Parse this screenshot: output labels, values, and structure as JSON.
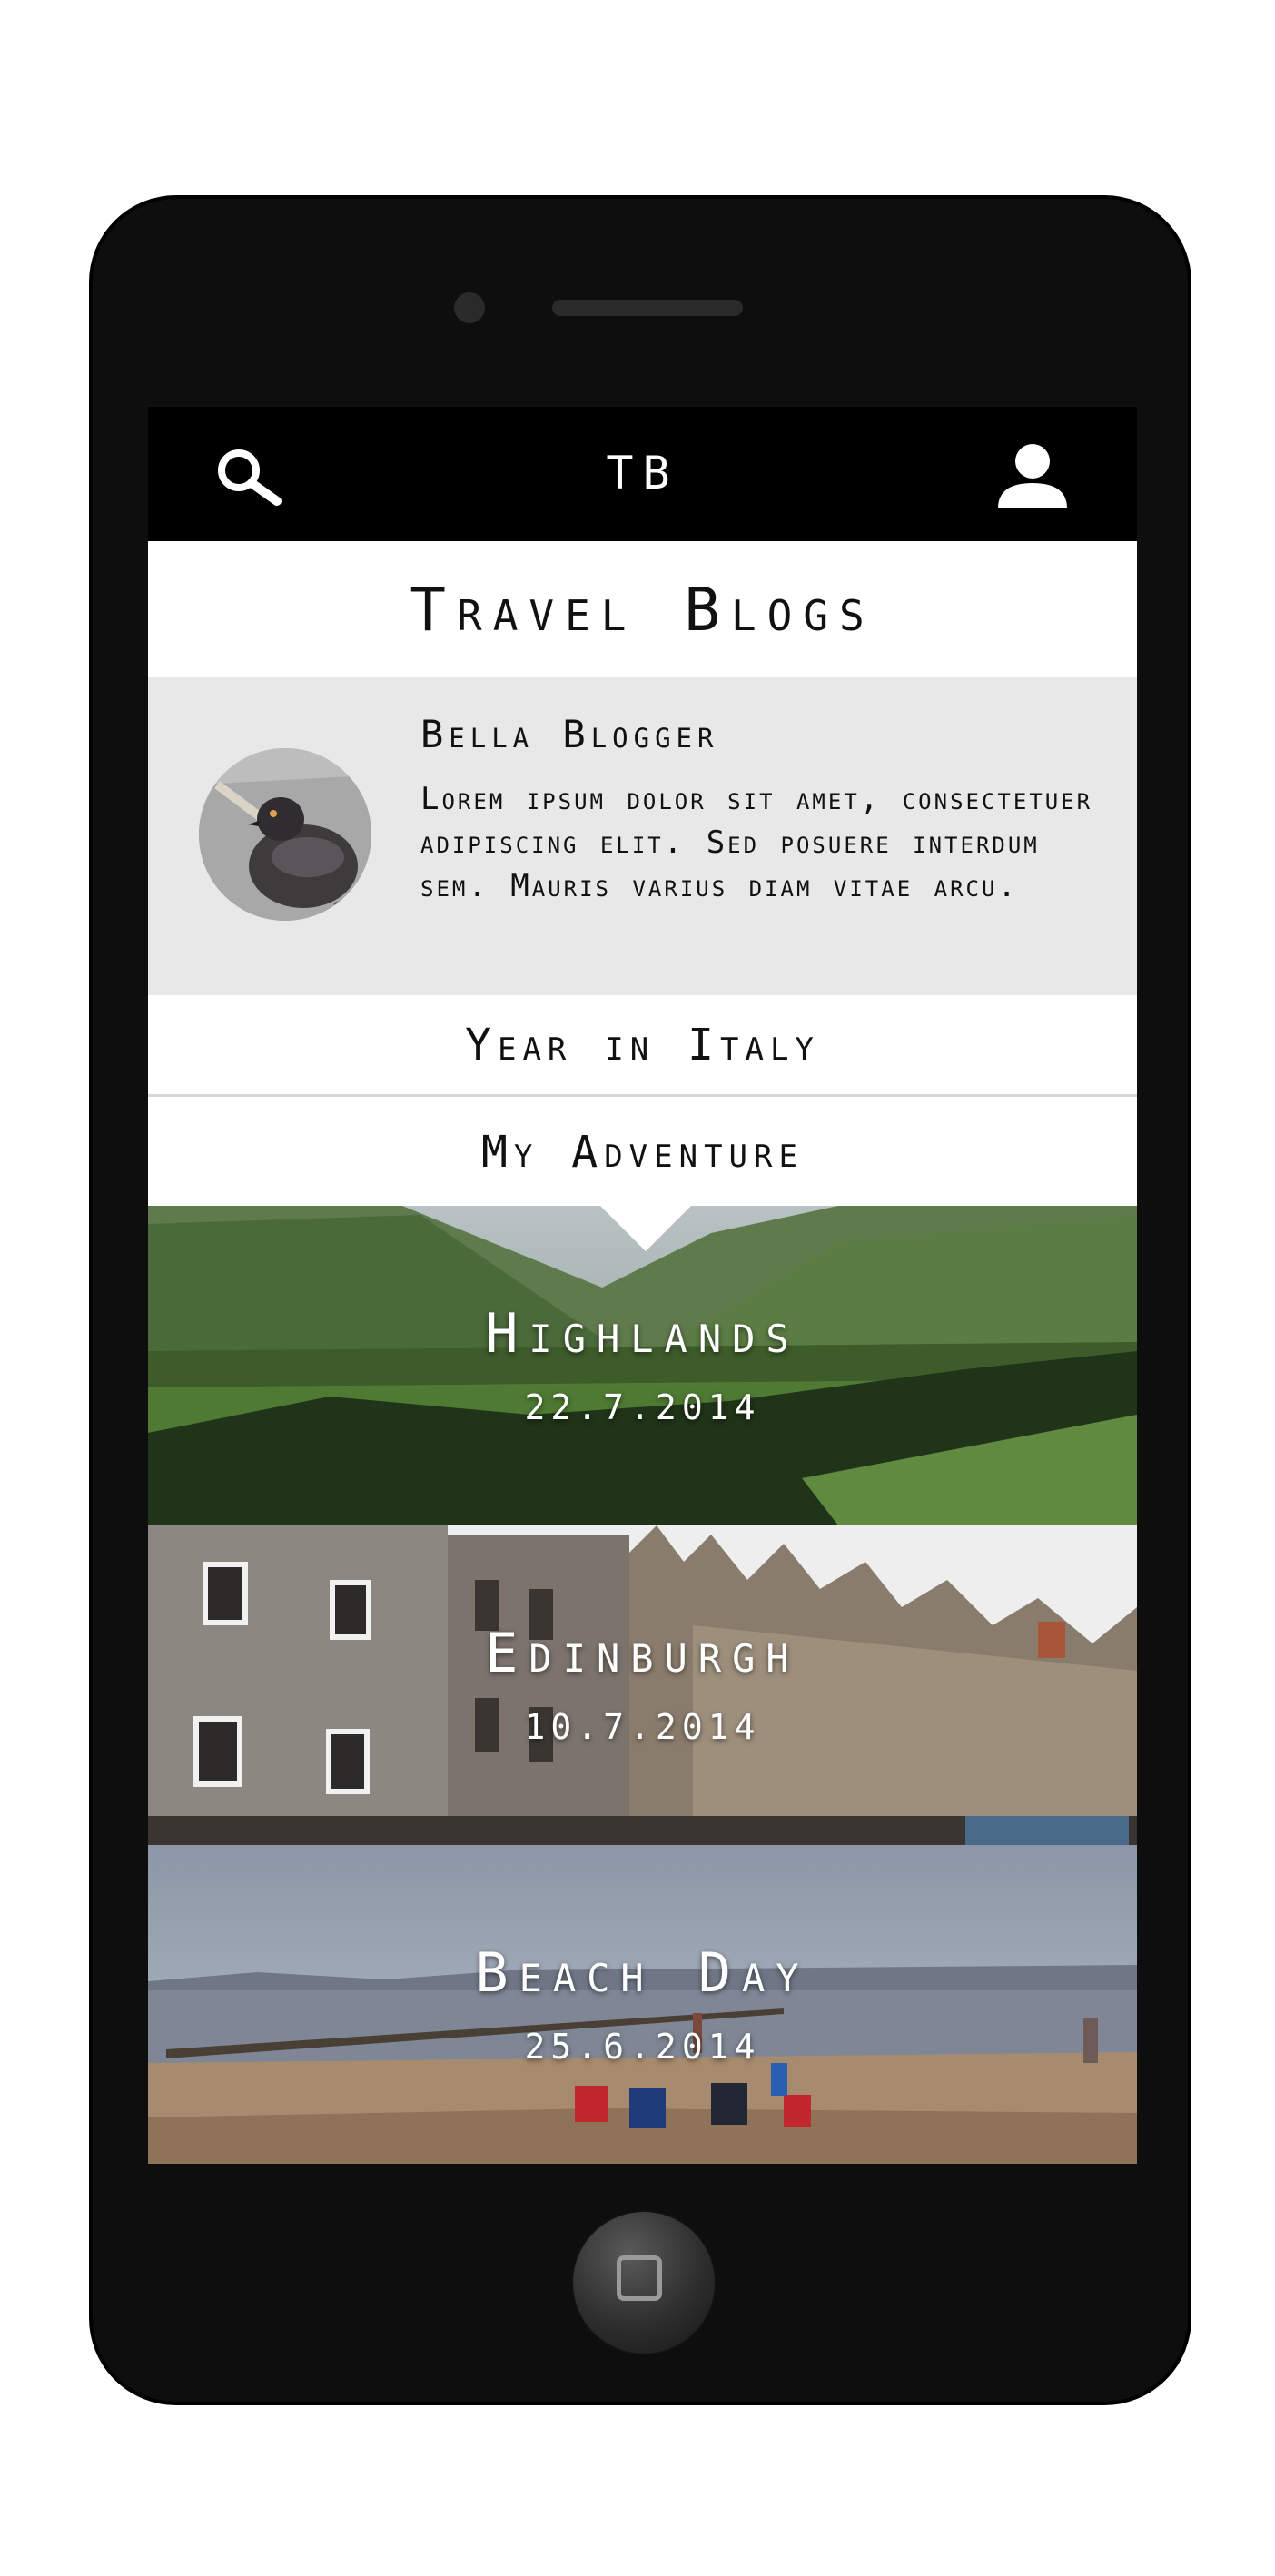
{
  "app": {
    "brand": "TB"
  },
  "header": {
    "title": "Travel Blogs"
  },
  "profile": {
    "name": "Bella Blogger",
    "bio": "Lorem ipsum dolor sit amet, consectetuer adipiscing elit. Sed posuere interdum sem. Mauris varius diam vitae arcu."
  },
  "tabs": [
    {
      "label": "Year in Italy"
    },
    {
      "label": "My Adventure"
    }
  ],
  "posts": [
    {
      "title": "Highlands",
      "date": "22.7.2014"
    },
    {
      "title": "Edinburgh",
      "date": "10.7.2014"
    },
    {
      "title": "Beach Day",
      "date": "25.6.2014"
    }
  ],
  "icons": {
    "search": "search-icon",
    "user": "user-icon",
    "home": "home-button-icon"
  },
  "colors": {
    "topbar": "#000000",
    "profile_bg": "#e8e8e8",
    "phone_body": "#0e0e0e"
  }
}
